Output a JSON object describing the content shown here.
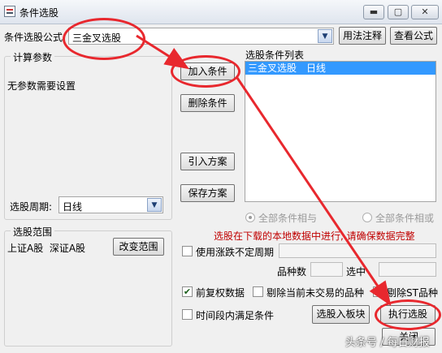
{
  "window": {
    "title": "条件选股",
    "minimize_glyph": "▬",
    "maximize_glyph": "▢",
    "close_glyph": "✕"
  },
  "formula": {
    "label": "条件选股公式",
    "selected": "三金叉选股",
    "usage_button": "用法注释",
    "view_button": "查看公式"
  },
  "params": {
    "group_title": "计算参数",
    "message": "无参数需要设置",
    "period_label": "选股周期:",
    "period_value": "日线"
  },
  "actions": {
    "add": "加入条件",
    "delete": "删除条件",
    "import": "引入方案",
    "save": "保存方案"
  },
  "condition_list": {
    "title": "选股条件列表",
    "items": [
      "三金叉选股　日线"
    ]
  },
  "logic": {
    "and": "全部条件相与",
    "or": "全部条件相或"
  },
  "warning": "选股在下载的本地数据中进行, 请确保数据完整",
  "scope": {
    "group_title": "选股范围",
    "value": "上证A股  深证A股",
    "change_button": "改变范围"
  },
  "options": {
    "limit_period": "使用涨跌不定周期",
    "count_label": "品种数",
    "hit_label": "选中",
    "adjust": "前复权数据",
    "exclude_untraded": "剔除当前未交易的品种",
    "exclude_st": "剔除ST品种",
    "time_range": "时间段内满足条件"
  },
  "bottom": {
    "to_block": "选股入板块",
    "execute": "执行选股",
    "close": "关闭"
  },
  "watermark": "头条号 / 每日财报",
  "colors": {
    "annotation_red": "#e8282e",
    "selection_blue": "#3399ff"
  }
}
